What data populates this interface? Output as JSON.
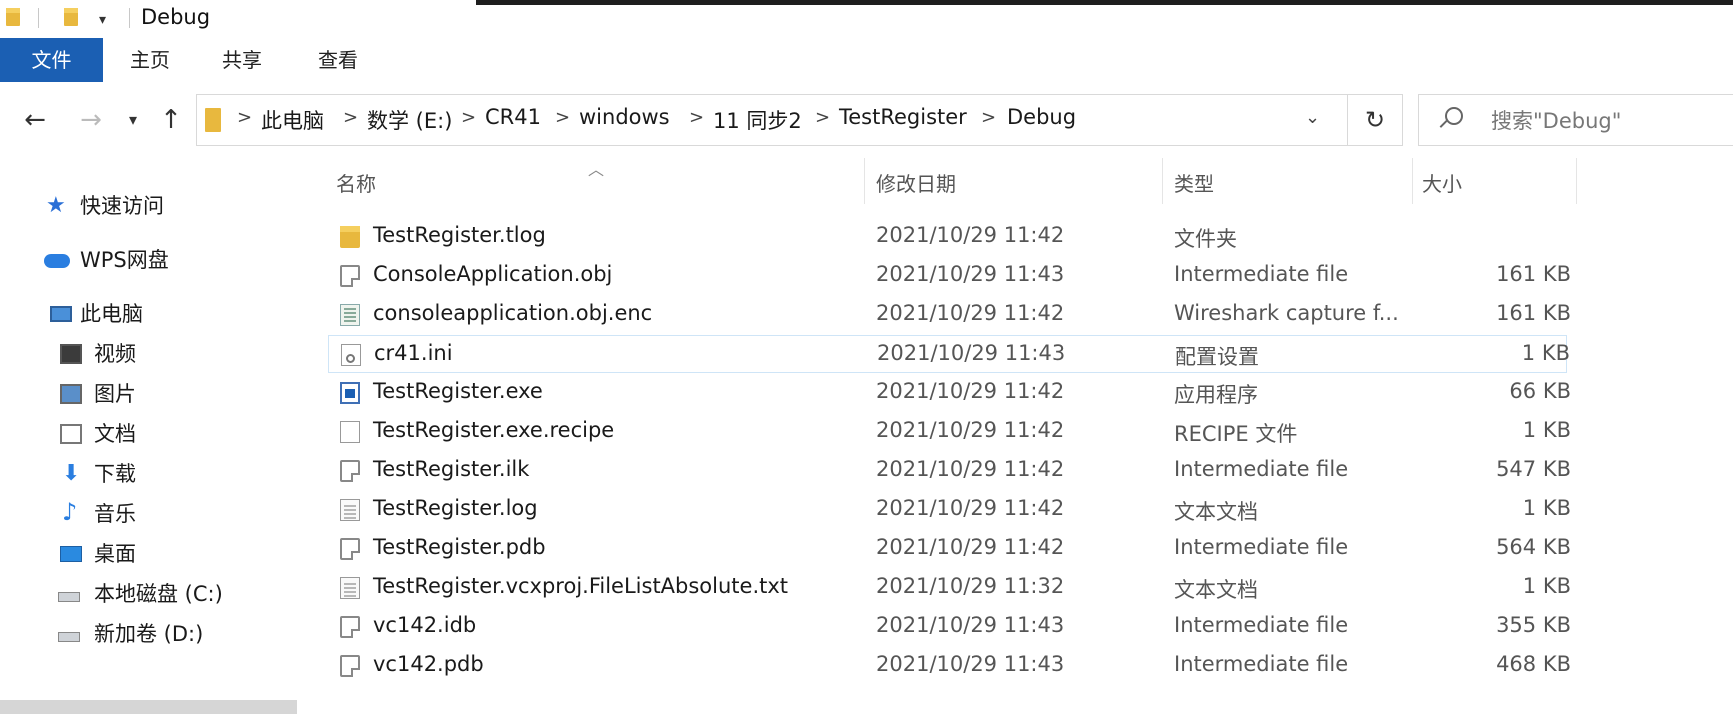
{
  "window": {
    "title": "Debug"
  },
  "ribbon": {
    "tabs": [
      "文件",
      "主页",
      "共享",
      "查看"
    ]
  },
  "address": {
    "crumbs": [
      "此电脑",
      "数学 (E:)",
      "CR41",
      "windows",
      "11 同步2",
      "TestRegister",
      "Debug"
    ],
    "separator": ">"
  },
  "search": {
    "placeholder": "搜索\"Debug\""
  },
  "sidebar": {
    "items": [
      {
        "label": "快速访问",
        "icon": "star-icon"
      },
      {
        "label": "WPS网盘",
        "icon": "cloud-icon"
      },
      {
        "label": "此电脑",
        "icon": "computer-icon"
      },
      {
        "label": "视频",
        "icon": "video-folder-icon"
      },
      {
        "label": "图片",
        "icon": "pictures-folder-icon"
      },
      {
        "label": "文档",
        "icon": "documents-folder-icon"
      },
      {
        "label": "下载",
        "icon": "download-arrow-icon"
      },
      {
        "label": "音乐",
        "icon": "music-note-icon"
      },
      {
        "label": "桌面",
        "icon": "desktop-folder-icon"
      },
      {
        "label": "本地磁盘 (C:)",
        "icon": "drive-icon"
      },
      {
        "label": "新加卷 (D:)",
        "icon": "drive-icon"
      }
    ]
  },
  "columns": {
    "name": "名称",
    "date": "修改日期",
    "type": "类型",
    "size": "大小"
  },
  "files": [
    {
      "name": "TestRegister.tlog",
      "date": "2021/10/29 11:42",
      "type": "文件夹",
      "size": "",
      "icon": "folder-icon"
    },
    {
      "name": "ConsoleApplication.obj",
      "date": "2021/10/29 11:43",
      "type": "Intermediate file",
      "size": "161 KB",
      "icon": "intermediate-file-icon"
    },
    {
      "name": "consoleapplication.obj.enc",
      "date": "2021/10/29 11:42",
      "type": "Wireshark capture f...",
      "size": "161 KB",
      "icon": "capture-file-icon"
    },
    {
      "name": "cr41.ini",
      "date": "2021/10/29 11:43",
      "type": "配置设置",
      "size": "1 KB",
      "icon": "config-file-icon"
    },
    {
      "name": "TestRegister.exe",
      "date": "2021/10/29 11:42",
      "type": "应用程序",
      "size": "66 KB",
      "icon": "application-icon"
    },
    {
      "name": "TestRegister.exe.recipe",
      "date": "2021/10/29 11:42",
      "type": "RECIPE 文件",
      "size": "1 KB",
      "icon": "blank-file-icon"
    },
    {
      "name": "TestRegister.ilk",
      "date": "2021/10/29 11:42",
      "type": "Intermediate file",
      "size": "547 KB",
      "icon": "intermediate-file-icon"
    },
    {
      "name": "TestRegister.log",
      "date": "2021/10/29 11:42",
      "type": "文本文档",
      "size": "1 KB",
      "icon": "text-file-icon"
    },
    {
      "name": "TestRegister.pdb",
      "date": "2021/10/29 11:42",
      "type": "Intermediate file",
      "size": "564 KB",
      "icon": "intermediate-file-icon"
    },
    {
      "name": "TestRegister.vcxproj.FileListAbsolute.txt",
      "date": "2021/10/29 11:32",
      "type": "文本文档",
      "size": "1 KB",
      "icon": "text-file-icon"
    },
    {
      "name": "vc142.idb",
      "date": "2021/10/29 11:43",
      "type": "Intermediate file",
      "size": "355 KB",
      "icon": "intermediate-file-icon"
    },
    {
      "name": "vc142.pdb",
      "date": "2021/10/29 11:43",
      "type": "Intermediate file",
      "size": "468 KB",
      "icon": "intermediate-file-icon"
    }
  ],
  "colors": {
    "ribbon_file_tab": "#1b5fb3",
    "folder": "#e8b83e",
    "selection_border": "#cfe5f7"
  }
}
